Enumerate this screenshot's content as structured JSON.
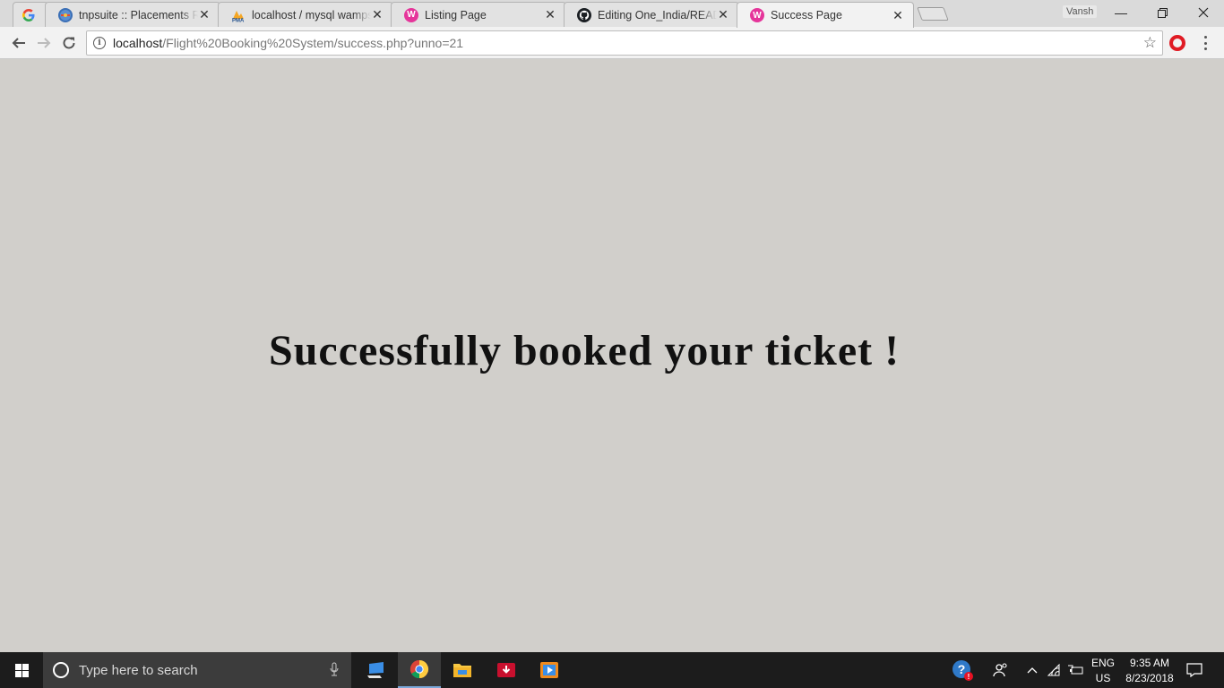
{
  "browser": {
    "tabs": [
      {
        "title": "",
        "favicon": "google-icon",
        "active": false
      },
      {
        "title": "tnpsuite :: Placements Re",
        "favicon": "tnpsuite-icon",
        "active": false
      },
      {
        "title": "localhost / mysql wampse",
        "favicon": "phpmyadmin-icon",
        "active": false
      },
      {
        "title": "Listing Page",
        "favicon": "wamp-icon",
        "active": false
      },
      {
        "title": "Editing One_India/READM",
        "favicon": "github-icon",
        "active": false
      },
      {
        "title": "Success Page",
        "favicon": "wamp-icon",
        "active": true
      }
    ],
    "profile_name": "Vansh",
    "url_host": "localhost",
    "url_path": "/Flight%20Booking%20System/success.php?unno=21"
  },
  "page": {
    "headline": "Successfully booked your ticket !"
  },
  "taskbar": {
    "search_placeholder": "Type here to search",
    "language_line1": "ENG",
    "language_line2": "US",
    "time": "9:35 AM",
    "date": "8/23/2018"
  },
  "colors": {
    "page_background": "#d1cfcb",
    "taskbar": "#1c1c1c",
    "wamp_pink": "#e5359a"
  }
}
